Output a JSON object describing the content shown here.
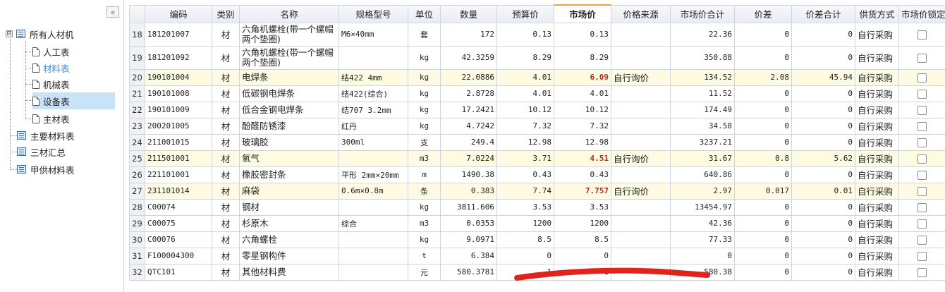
{
  "tree": {
    "collapse_glyph": "«",
    "root": {
      "label": "所有人材机",
      "expander": "⊟"
    },
    "children": [
      "人工表",
      "材料表",
      "机械表",
      "设备表",
      "主材表"
    ],
    "others": [
      "主要材料表",
      "三材汇总",
      "甲供材料表"
    ]
  },
  "grid": {
    "headers": [
      "",
      "编码",
      "类别",
      "名称",
      "规格型号",
      "单位",
      "数量",
      "预算价",
      "市场价",
      "价格来源",
      "市场价合计",
      "价差",
      "价差合计",
      "供货方式",
      "市场价锁定"
    ],
    "rows": [
      {
        "n": "18",
        "code": "181201007",
        "type": "材",
        "name": "六角机螺栓(带一个螺帽两个垫圈)",
        "spec": "M6×40mm",
        "unit": "套",
        "qty": "172",
        "budget": "0.13",
        "market": "0.13",
        "source": "",
        "total": "22.36",
        "diff": "0",
        "diff_total": "0",
        "supply": "自行采购"
      },
      {
        "n": "19",
        "code": "181201092",
        "type": "材",
        "name": "六角机螺栓(带一个螺帽两个垫圈)",
        "spec": "",
        "unit": "kg",
        "qty": "42.3259",
        "budget": "8.29",
        "market": "8.29",
        "source": "",
        "total": "350.88",
        "diff": "0",
        "diff_total": "0",
        "supply": "自行采购"
      },
      {
        "n": "20",
        "code": "190101004",
        "type": "材",
        "name": "电焊条",
        "spec": "结422 4mm",
        "unit": "kg",
        "qty": "22.0886",
        "budget": "4.01",
        "market": "6.09",
        "source": "自行询价",
        "total": "134.52",
        "diff": "2.08",
        "diff_total": "45.94",
        "supply": "自行采购"
      },
      {
        "n": "21",
        "code": "190101008",
        "type": "材",
        "name": "低碳钢电焊条",
        "spec": "结422(综合)",
        "unit": "kg",
        "qty": "2.8728",
        "budget": "4.01",
        "market": "4.01",
        "source": "",
        "total": "11.52",
        "diff": "0",
        "diff_total": "0",
        "supply": "自行采购"
      },
      {
        "n": "22",
        "code": "190101009",
        "type": "材",
        "name": "低合金钢电焊条",
        "spec": "结707 3.2mm",
        "unit": "kg",
        "qty": "17.2421",
        "budget": "10.12",
        "market": "10.12",
        "source": "",
        "total": "174.49",
        "diff": "0",
        "diff_total": "0",
        "supply": "自行采购"
      },
      {
        "n": "23",
        "code": "200201005",
        "type": "材",
        "name": "酚醛防锈漆",
        "spec": "红丹",
        "unit": "kg",
        "qty": "4.7242",
        "budget": "7.32",
        "market": "7.32",
        "source": "",
        "total": "34.58",
        "diff": "0",
        "diff_total": "0",
        "supply": "自行采购"
      },
      {
        "n": "24",
        "code": "211001015",
        "type": "材",
        "name": "玻璃胶",
        "spec": "300ml",
        "unit": "支",
        "qty": "249.4",
        "budget": "12.98",
        "market": "12.98",
        "source": "",
        "total": "3237.21",
        "diff": "0",
        "diff_total": "0",
        "supply": "自行采购"
      },
      {
        "n": "25",
        "code": "211501001",
        "type": "材",
        "name": "氧气",
        "spec": "",
        "unit": "m3",
        "qty": "7.0224",
        "budget": "3.71",
        "market": "4.51",
        "source": "自行询价",
        "total": "31.67",
        "diff": "0.8",
        "diff_total": "5.62",
        "supply": "自行采购"
      },
      {
        "n": "26",
        "code": "221101001",
        "type": "材",
        "name": "橡胶密封条",
        "spec": "平形 2mm×20mm",
        "unit": "m",
        "qty": "1490.38",
        "budget": "0.43",
        "market": "0.43",
        "source": "",
        "total": "640.86",
        "diff": "0",
        "diff_total": "0",
        "supply": "自行采购"
      },
      {
        "n": "27",
        "code": "231101014",
        "type": "材",
        "name": "麻袋",
        "spec": "0.6m×0.8m",
        "unit": "条",
        "qty": "0.383",
        "budget": "7.74",
        "market": "7.757",
        "source": "自行询价",
        "total": "2.97",
        "diff": "0.017",
        "diff_total": "0.01",
        "supply": "自行采购"
      },
      {
        "n": "28",
        "code": "C00074",
        "type": "材",
        "name": "钢材",
        "spec": "",
        "unit": "kg",
        "qty": "3811.606",
        "budget": "3.53",
        "market": "3.53",
        "source": "",
        "total": "13454.97",
        "diff": "0",
        "diff_total": "0",
        "supply": "自行采购"
      },
      {
        "n": "29",
        "code": "C00075",
        "type": "材",
        "name": "杉原木",
        "spec": "综合",
        "unit": "m3",
        "qty": "0.0353",
        "budget": "1200",
        "market": "1200",
        "source": "",
        "total": "42.36",
        "diff": "0",
        "diff_total": "0",
        "supply": "自行采购"
      },
      {
        "n": "30",
        "code": "C00076",
        "type": "材",
        "name": "六角螺栓",
        "spec": "",
        "unit": "kg",
        "qty": "9.0971",
        "budget": "8.5",
        "market": "8.5",
        "source": "",
        "total": "77.33",
        "diff": "0",
        "diff_total": "0",
        "supply": "自行采购"
      },
      {
        "n": "31",
        "code": "F100004300",
        "type": "材",
        "name": "零星钢构件",
        "spec": "",
        "unit": "t",
        "qty": "6.384",
        "budget": "0",
        "market": "0",
        "source": "",
        "total": "0",
        "diff": "0",
        "diff_total": "0",
        "supply": "自行采购"
      },
      {
        "n": "32",
        "code": "QTC101",
        "type": "材",
        "name": "其他材料费",
        "spec": "",
        "unit": "元",
        "qty": "580.3781",
        "budget": "1",
        "market": "1",
        "source": "",
        "total": "580.38",
        "diff": "0",
        "diff_total": "0",
        "supply": "自行采购"
      }
    ]
  },
  "colors": {
    "highlight_row": "#fdfce3",
    "market_changed": "#c0281e",
    "selected_tree_item": "#c8e2f7",
    "active_tree_item": "#4a86c8",
    "annotation_stroke": "#e0241b"
  }
}
